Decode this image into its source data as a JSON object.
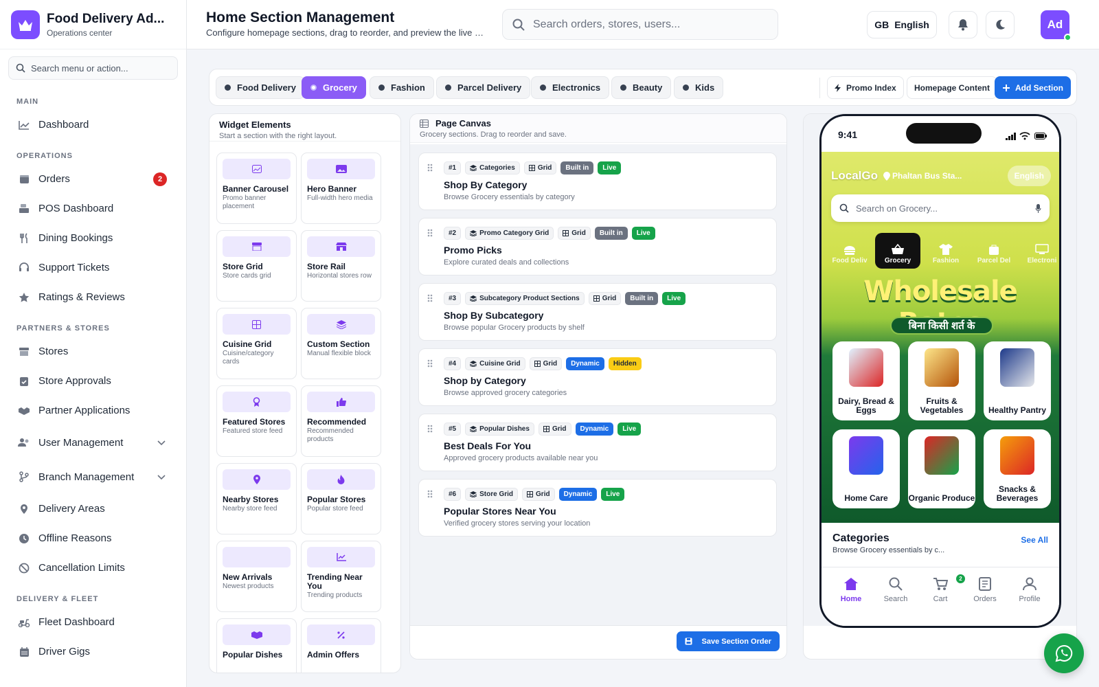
{
  "brand": {
    "title": "Food Delivery Ad...",
    "subtitle": "Operations center"
  },
  "sidebar": {
    "search_placeholder": "Search menu or action...",
    "sections": [
      {
        "label": "MAIN"
      },
      {
        "label": "OPERATIONS"
      },
      {
        "label": "PARTNERS & STORES"
      },
      {
        "label": "DELIVERY & FLEET"
      }
    ],
    "items": {
      "dashboard": "Dashboard",
      "orders": "Orders",
      "orders_badge": "2",
      "pos": "POS Dashboard",
      "dining": "Dining Bookings",
      "support": "Support Tickets",
      "ratings": "Ratings & Reviews",
      "stores": "Stores",
      "store_approvals": "Store Approvals",
      "partner_apps": "Partner Applications",
      "user_mgmt": "User Management",
      "branch_mgmt": "Branch Management",
      "delivery_areas": "Delivery Areas",
      "offline_reasons": "Offline Reasons",
      "cancellation": "Cancellation Limits",
      "fleet": "Fleet Dashboard",
      "driver_gigs": "Driver Gigs"
    }
  },
  "header": {
    "title": "Home Section Management",
    "subtitle": "Configure homepage sections, drag to reorder, and preview the live app layout.",
    "search_placeholder": "Search orders, stores, users...",
    "lang_flag": "GB",
    "lang_label": "English",
    "avatar": "Ad"
  },
  "tabs": [
    "Food Delivery",
    "Grocery",
    "Fashion",
    "Parcel Delivery",
    "Electronics",
    "Beauty",
    "Kids"
  ],
  "active_tab": "Grocery",
  "actions": {
    "promo_index": "Promo Index",
    "homepage_content": "Homepage Content",
    "add_section": "Add Section"
  },
  "widgets": {
    "title": "Widget Elements",
    "subtitle": "Start a section with the right layout.",
    "items": [
      {
        "name": "Banner Carousel",
        "desc": "Promo banner placement",
        "icon": "image-icon"
      },
      {
        "name": "Hero Banner",
        "desc": "Full-width hero media",
        "icon": "hero-image-icon"
      },
      {
        "name": "Store Grid",
        "desc": "Store cards grid",
        "icon": "store-icon"
      },
      {
        "name": "Store Rail",
        "desc": "Horizontal stores row",
        "icon": "storefront-icon"
      },
      {
        "name": "Cuisine Grid",
        "desc": "Cuisine/category cards",
        "icon": "grid-icon"
      },
      {
        "name": "Custom Section",
        "desc": "Manual flexible block",
        "icon": "layers-icon"
      },
      {
        "name": "Featured Stores",
        "desc": "Featured store feed",
        "icon": "award-icon"
      },
      {
        "name": "Recommended",
        "desc": "Recommended products",
        "icon": "thumbs-up-icon"
      },
      {
        "name": "Nearby Stores",
        "desc": "Nearby store feed",
        "icon": "location-pin-icon"
      },
      {
        "name": "Popular Stores",
        "desc": "Popular store feed",
        "icon": "fire-icon"
      },
      {
        "name": "New Arrivals",
        "desc": "Newest products",
        "icon": "sparkle-icon"
      },
      {
        "name": "Trending Near You",
        "desc": "Trending products",
        "icon": "chart-line-icon"
      },
      {
        "name": "Popular Dishes",
        "desc": "",
        "icon": "boxes-icon"
      },
      {
        "name": "Admin Offers",
        "desc": "",
        "icon": "percent-icon"
      }
    ]
  },
  "canvas": {
    "title": "Page Canvas",
    "subtitle": "Grocery sections. Drag to reorder and save.",
    "save_label": "Save Section Order",
    "sections": [
      {
        "num": "#1",
        "type": "Categories",
        "layout": "Grid",
        "origin": "Built in",
        "status": "Live",
        "name": "Shop By Category",
        "desc": "Browse Grocery essentials by category"
      },
      {
        "num": "#2",
        "type": "Promo Category Grid",
        "layout": "Grid",
        "origin": "Built in",
        "status": "Live",
        "name": "Promo Picks",
        "desc": "Explore curated deals and collections"
      },
      {
        "num": "#3",
        "type": "Subcategory Product Sections",
        "layout": "Grid",
        "origin": "Built in",
        "status": "Live",
        "name": "Shop By Subcategory",
        "desc": "Browse popular Grocery products by shelf"
      },
      {
        "num": "#4",
        "type": "Cuisine Grid",
        "layout": "Grid",
        "origin": "Dynamic",
        "status": "Hidden",
        "name": "Shop by Category",
        "desc": "Browse approved grocery categories"
      },
      {
        "num": "#5",
        "type": "Popular Dishes",
        "layout": "Grid",
        "origin": "Dynamic",
        "status": "Live",
        "name": "Best Deals For You",
        "desc": "Approved grocery products available near you"
      },
      {
        "num": "#6",
        "type": "Store Grid",
        "layout": "Grid",
        "origin": "Dynamic",
        "status": "Live",
        "name": "Popular Stores Near You",
        "desc": "Verified grocery stores serving your location"
      }
    ]
  },
  "phone": {
    "time": "9:41",
    "app_name": "LocalGo",
    "location": "Phaltan Bus Sta...",
    "lang": "English",
    "search_placeholder": "Search on Grocery...",
    "tabs": [
      "Food Deliv",
      "Grocery",
      "Fashion",
      "Parcel Del",
      "Electroni"
    ],
    "promo_title": "Wholesale Rates",
    "promo_sub": "बिना किसी शर्त के",
    "categories": [
      "Dairy, Bread & Eggs",
      "Fruits & Vegetables",
      "Healthy Pantry",
      "Home Care",
      "Organic Produce",
      "Snacks & Beverages"
    ],
    "cats_title": "Categories",
    "cats_sub": "Browse Grocery essentials by c...",
    "see_all": "See All",
    "nav": [
      "Home",
      "Search",
      "Cart",
      "Orders",
      "Profile"
    ],
    "cart_count": "2"
  },
  "colors": {
    "accent": "#7c4dff",
    "primary_blue": "#1d6ee6",
    "live_green": "#16a34a",
    "hidden_yellow": "#facc15"
  }
}
